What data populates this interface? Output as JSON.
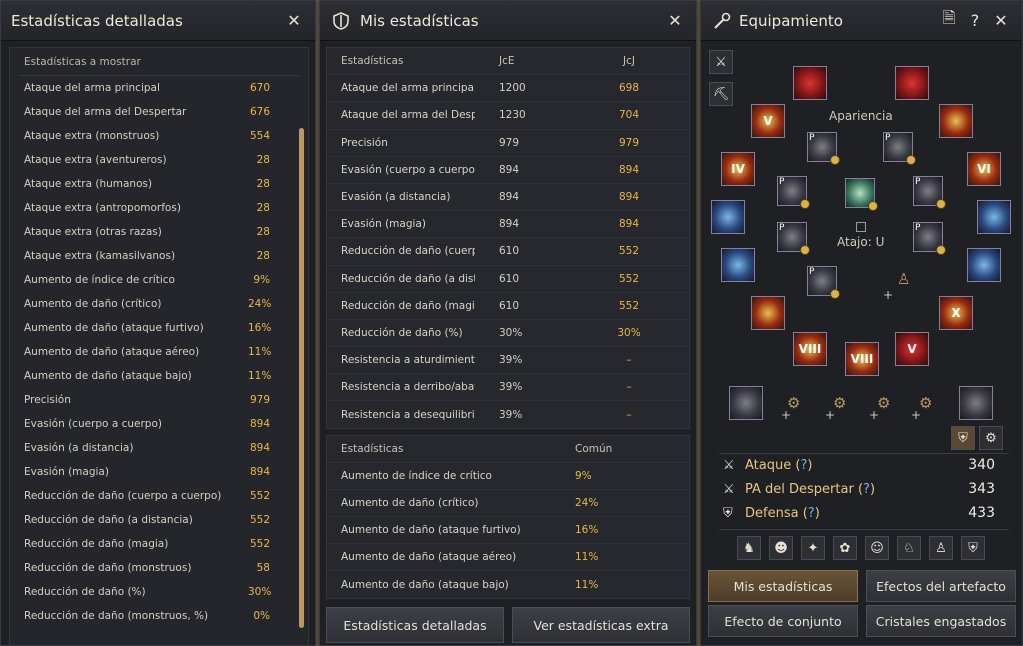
{
  "detailed_window": {
    "title": "Estadísticas detalladas",
    "header": "Estadísticas a mostrar",
    "rows": [
      {
        "label": "Ataque del arma principal",
        "value": "670"
      },
      {
        "label": "Ataque del arma del Despertar",
        "value": "676"
      },
      {
        "label": "Ataque extra (monstruos)",
        "value": "554"
      },
      {
        "label": "Ataque extra (aventureros)",
        "value": "28"
      },
      {
        "label": "Ataque extra (humanos)",
        "value": "28"
      },
      {
        "label": "Ataque extra (antropomorfos)",
        "value": "28"
      },
      {
        "label": "Ataque extra (otras razas)",
        "value": "28"
      },
      {
        "label": "Ataque extra (kamasilvanos)",
        "value": "28"
      },
      {
        "label": "Aumento de índice de crítico",
        "value": "9%"
      },
      {
        "label": "Aumento de daño (crítico)",
        "value": "24%"
      },
      {
        "label": "Aumento de daño (ataque furtivo)",
        "value": "16%"
      },
      {
        "label": "Aumento de daño (ataque aéreo)",
        "value": "11%"
      },
      {
        "label": "Aumento de daño (ataque bajo)",
        "value": "11%"
      },
      {
        "label": "Precisión",
        "value": "979"
      },
      {
        "label": "Evasión (cuerpo a cuerpo)",
        "value": "894"
      },
      {
        "label": "Evasión (a distancia)",
        "value": "894"
      },
      {
        "label": "Evasión (magia)",
        "value": "894"
      },
      {
        "label": "Reducción de daño (cuerpo a cuerpo)",
        "value": "552"
      },
      {
        "label": "Reducción de daño (a distancia)",
        "value": "552"
      },
      {
        "label": "Reducción de daño (magia)",
        "value": "552"
      },
      {
        "label": "Reducción de daño (monstruos)",
        "value": "58"
      },
      {
        "label": "Reducción de daño (%)",
        "value": "30%"
      },
      {
        "label": "Reducción de daño (monstruos, %)",
        "value": "0%"
      }
    ]
  },
  "my_stats_window": {
    "title": "Mis estadísticas",
    "table1": {
      "headers": [
        "Estadísticas",
        "JcE",
        "JcJ"
      ],
      "rows": [
        [
          "Ataque del arma principal",
          "1200",
          "698"
        ],
        [
          "Ataque del arma del Despertar",
          "1230",
          "704"
        ],
        [
          "Precisión",
          "979",
          "979"
        ],
        [
          "Evasión (cuerpo a cuerpo)",
          "894",
          "894"
        ],
        [
          "Evasión (a distancia)",
          "894",
          "894"
        ],
        [
          "Evasión (magia)",
          "894",
          "894"
        ],
        [
          "Reducción de daño (cuerpo...",
          "610",
          "552"
        ],
        [
          "Reducción de daño (a dista...",
          "610",
          "552"
        ],
        [
          "Reducción de daño (magia)",
          "610",
          "552"
        ],
        [
          "Reducción de daño (%)",
          "30%",
          "30%"
        ],
        [
          "Resistencia a aturdimiento/...",
          "39%",
          "–"
        ],
        [
          "Resistencia a derribo/abati...",
          "39%",
          "–"
        ],
        [
          "Resistencia a desequilibrio...",
          "39%",
          "–"
        ]
      ]
    },
    "table2": {
      "headers": [
        "Estadísticas",
        "Común"
      ],
      "rows": [
        [
          "Aumento de índice de crítico",
          "9%"
        ],
        [
          "Aumento de daño (crítico)",
          "24%"
        ],
        [
          "Aumento de daño (ataque furtivo)",
          "16%"
        ],
        [
          "Aumento de daño (ataque aéreo)",
          "11%"
        ],
        [
          "Aumento de daño (ataque bajo)",
          "11%"
        ]
      ]
    },
    "buttons": {
      "detailed": "Estadísticas detalladas",
      "extra": "Ver estadísticas extra"
    }
  },
  "equipment_window": {
    "title": "Equipamiento",
    "apariencia": "Apariencia",
    "atajo": "Atajo: U",
    "slot_labels": {
      "gloves_right": "VI",
      "ring1": "V",
      "ring2": "IV",
      "belt": "VIII",
      "boots": "VIII",
      "shoes": "V",
      "earring": "X",
      "necklace": "X"
    },
    "p_badge": "P",
    "plus": "+",
    "stats": [
      {
        "label": "Ataque",
        "q": "?",
        "value": "340"
      },
      {
        "label": "PA del Despertar",
        "q": "?",
        "value": "343"
      },
      {
        "label": "Defensa",
        "q": "?",
        "value": "433"
      }
    ],
    "buttons": {
      "my_stats": "Mis estadísticas",
      "artifact": "Efectos del artefacto",
      "set": "Efecto de conjunto",
      "crystals": "Cristales engastados"
    }
  }
}
